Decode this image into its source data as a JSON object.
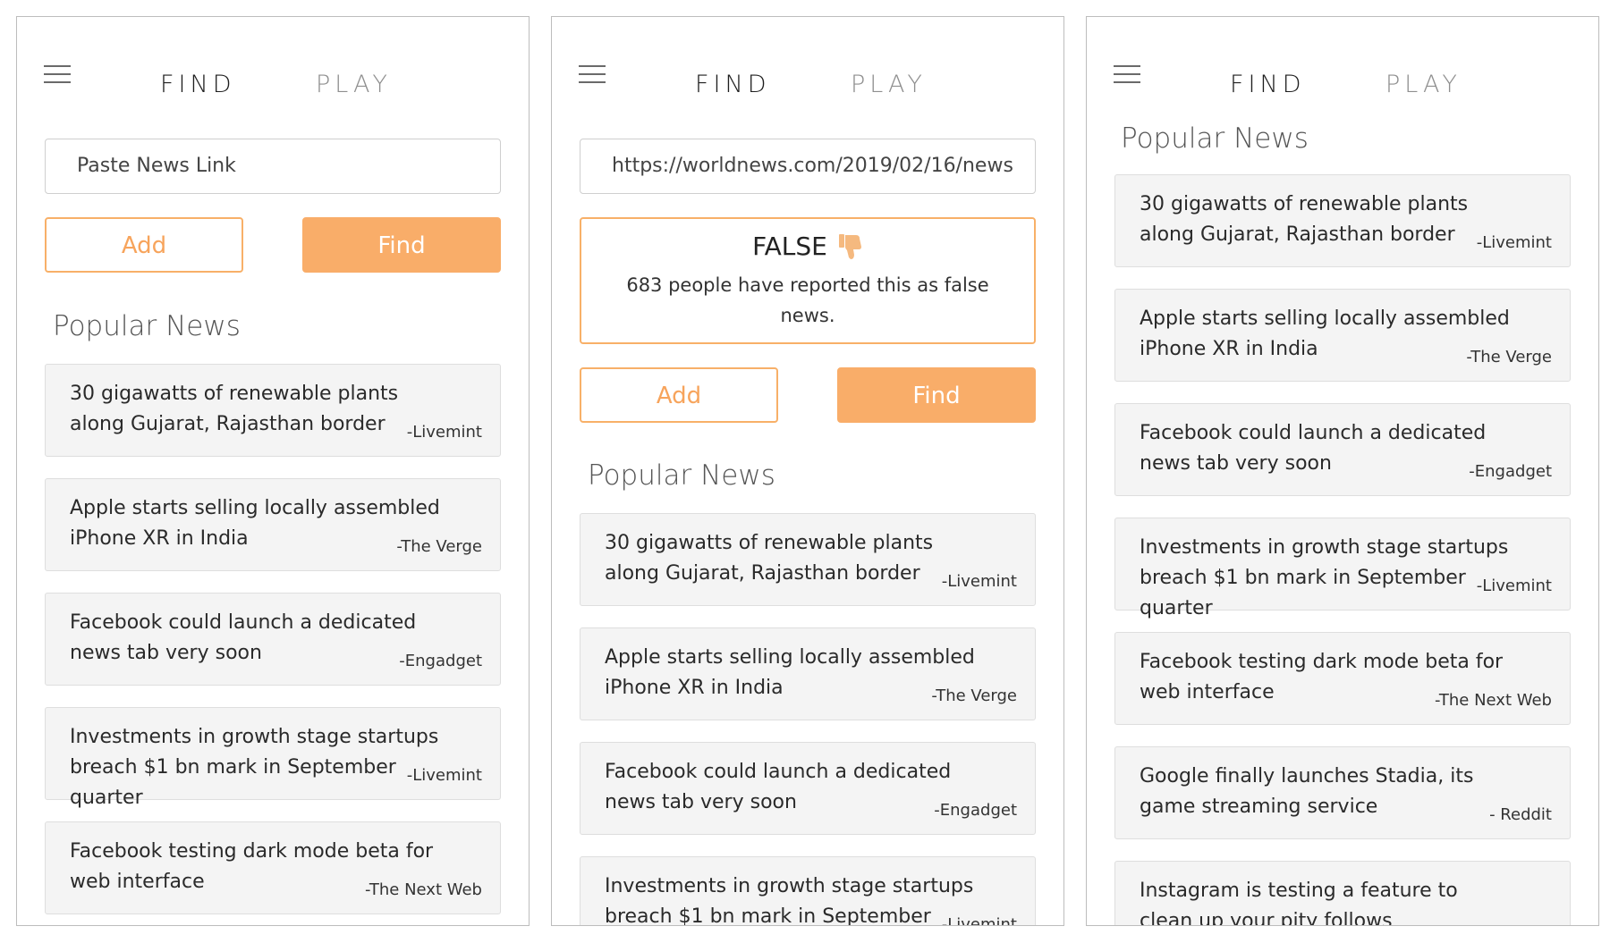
{
  "tabs": {
    "find": "FIND",
    "play": "PLAY"
  },
  "input": {
    "placeholder": "Paste News Link",
    "filled_value": "https://worldnews.com/2019/02/16/news"
  },
  "buttons": {
    "add": "Add",
    "find": "Find"
  },
  "verdict": {
    "title": "FALSE",
    "message": "683 people have reported this as false news."
  },
  "section_title": "Popular News",
  "colors": {
    "accent": "#f9ad69",
    "accent_border": "#f8b068",
    "card_bg": "#f4f4f4"
  },
  "news": [
    {
      "title": "30 gigawatts of renewable plants along Gujarat, Rajasthan border",
      "source": "-Livemint"
    },
    {
      "title": "Apple starts selling locally assembled iPhone XR in India",
      "source": "-The Verge"
    },
    {
      "title": "Facebook could launch a dedicated news tab very soon",
      "source": "-Engadget"
    },
    {
      "title": "Investments in growth stage startups breach $1 bn mark in September quarter",
      "source": "-Livemint"
    },
    {
      "title": "Facebook testing dark mode beta for web interface",
      "source": "-The Next Web"
    },
    {
      "title": "Google finally launches Stadia, its game streaming service",
      "source": "- Reddit"
    },
    {
      "title": "Instagram is testing a feature to clean up your pity follows",
      "source": ""
    }
  ]
}
